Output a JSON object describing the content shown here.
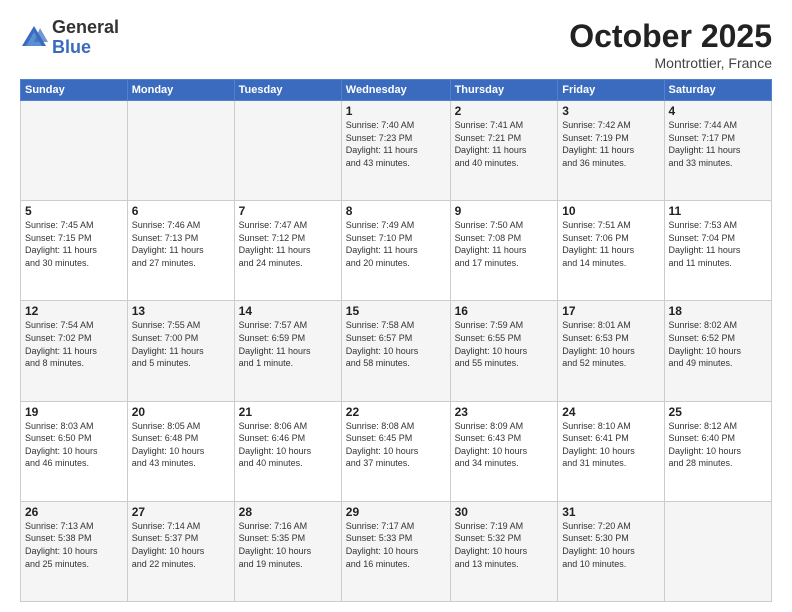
{
  "header": {
    "logo_general": "General",
    "logo_blue": "Blue",
    "month_title": "October 2025",
    "location": "Montrottier, France"
  },
  "days_of_week": [
    "Sunday",
    "Monday",
    "Tuesday",
    "Wednesday",
    "Thursday",
    "Friday",
    "Saturday"
  ],
  "weeks": [
    [
      {
        "day": "",
        "info": ""
      },
      {
        "day": "",
        "info": ""
      },
      {
        "day": "",
        "info": ""
      },
      {
        "day": "1",
        "info": "Sunrise: 7:40 AM\nSunset: 7:23 PM\nDaylight: 11 hours\nand 43 minutes."
      },
      {
        "day": "2",
        "info": "Sunrise: 7:41 AM\nSunset: 7:21 PM\nDaylight: 11 hours\nand 40 minutes."
      },
      {
        "day": "3",
        "info": "Sunrise: 7:42 AM\nSunset: 7:19 PM\nDaylight: 11 hours\nand 36 minutes."
      },
      {
        "day": "4",
        "info": "Sunrise: 7:44 AM\nSunset: 7:17 PM\nDaylight: 11 hours\nand 33 minutes."
      }
    ],
    [
      {
        "day": "5",
        "info": "Sunrise: 7:45 AM\nSunset: 7:15 PM\nDaylight: 11 hours\nand 30 minutes."
      },
      {
        "day": "6",
        "info": "Sunrise: 7:46 AM\nSunset: 7:13 PM\nDaylight: 11 hours\nand 27 minutes."
      },
      {
        "day": "7",
        "info": "Sunrise: 7:47 AM\nSunset: 7:12 PM\nDaylight: 11 hours\nand 24 minutes."
      },
      {
        "day": "8",
        "info": "Sunrise: 7:49 AM\nSunset: 7:10 PM\nDaylight: 11 hours\nand 20 minutes."
      },
      {
        "day": "9",
        "info": "Sunrise: 7:50 AM\nSunset: 7:08 PM\nDaylight: 11 hours\nand 17 minutes."
      },
      {
        "day": "10",
        "info": "Sunrise: 7:51 AM\nSunset: 7:06 PM\nDaylight: 11 hours\nand 14 minutes."
      },
      {
        "day": "11",
        "info": "Sunrise: 7:53 AM\nSunset: 7:04 PM\nDaylight: 11 hours\nand 11 minutes."
      }
    ],
    [
      {
        "day": "12",
        "info": "Sunrise: 7:54 AM\nSunset: 7:02 PM\nDaylight: 11 hours\nand 8 minutes."
      },
      {
        "day": "13",
        "info": "Sunrise: 7:55 AM\nSunset: 7:00 PM\nDaylight: 11 hours\nand 5 minutes."
      },
      {
        "day": "14",
        "info": "Sunrise: 7:57 AM\nSunset: 6:59 PM\nDaylight: 11 hours\nand 1 minute."
      },
      {
        "day": "15",
        "info": "Sunrise: 7:58 AM\nSunset: 6:57 PM\nDaylight: 10 hours\nand 58 minutes."
      },
      {
        "day": "16",
        "info": "Sunrise: 7:59 AM\nSunset: 6:55 PM\nDaylight: 10 hours\nand 55 minutes."
      },
      {
        "day": "17",
        "info": "Sunrise: 8:01 AM\nSunset: 6:53 PM\nDaylight: 10 hours\nand 52 minutes."
      },
      {
        "day": "18",
        "info": "Sunrise: 8:02 AM\nSunset: 6:52 PM\nDaylight: 10 hours\nand 49 minutes."
      }
    ],
    [
      {
        "day": "19",
        "info": "Sunrise: 8:03 AM\nSunset: 6:50 PM\nDaylight: 10 hours\nand 46 minutes."
      },
      {
        "day": "20",
        "info": "Sunrise: 8:05 AM\nSunset: 6:48 PM\nDaylight: 10 hours\nand 43 minutes."
      },
      {
        "day": "21",
        "info": "Sunrise: 8:06 AM\nSunset: 6:46 PM\nDaylight: 10 hours\nand 40 minutes."
      },
      {
        "day": "22",
        "info": "Sunrise: 8:08 AM\nSunset: 6:45 PM\nDaylight: 10 hours\nand 37 minutes."
      },
      {
        "day": "23",
        "info": "Sunrise: 8:09 AM\nSunset: 6:43 PM\nDaylight: 10 hours\nand 34 minutes."
      },
      {
        "day": "24",
        "info": "Sunrise: 8:10 AM\nSunset: 6:41 PM\nDaylight: 10 hours\nand 31 minutes."
      },
      {
        "day": "25",
        "info": "Sunrise: 8:12 AM\nSunset: 6:40 PM\nDaylight: 10 hours\nand 28 minutes."
      }
    ],
    [
      {
        "day": "26",
        "info": "Sunrise: 7:13 AM\nSunset: 5:38 PM\nDaylight: 10 hours\nand 25 minutes."
      },
      {
        "day": "27",
        "info": "Sunrise: 7:14 AM\nSunset: 5:37 PM\nDaylight: 10 hours\nand 22 minutes."
      },
      {
        "day": "28",
        "info": "Sunrise: 7:16 AM\nSunset: 5:35 PM\nDaylight: 10 hours\nand 19 minutes."
      },
      {
        "day": "29",
        "info": "Sunrise: 7:17 AM\nSunset: 5:33 PM\nDaylight: 10 hours\nand 16 minutes."
      },
      {
        "day": "30",
        "info": "Sunrise: 7:19 AM\nSunset: 5:32 PM\nDaylight: 10 hours\nand 13 minutes."
      },
      {
        "day": "31",
        "info": "Sunrise: 7:20 AM\nSunset: 5:30 PM\nDaylight: 10 hours\nand 10 minutes."
      },
      {
        "day": "",
        "info": ""
      }
    ]
  ]
}
